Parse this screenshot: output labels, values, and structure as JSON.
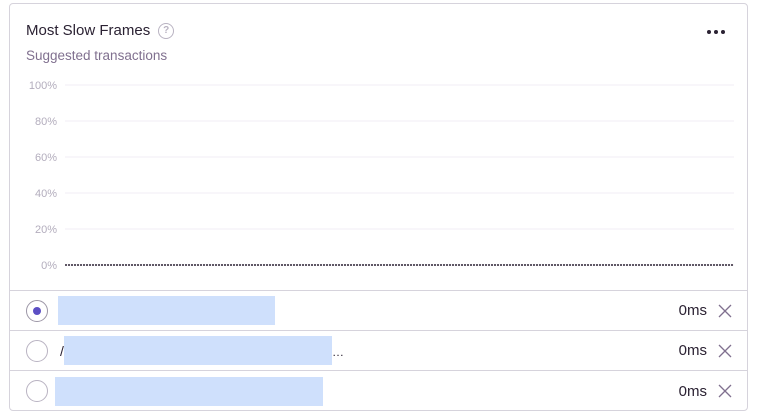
{
  "widget": {
    "title": "Most Slow Frames",
    "subtitle": "Suggested transactions",
    "help_icon": "question-circle-icon",
    "menu_icon": "ellipsis-icon"
  },
  "chart_data": {
    "type": "line",
    "y_ticks": [
      "100%",
      "80%",
      "60%",
      "40%",
      "20%",
      "0%"
    ],
    "ylim": [
      0,
      100
    ],
    "grid": true,
    "series": [
      {
        "values": [
          0,
          0
        ]
      }
    ]
  },
  "transactions": [
    {
      "selected": true,
      "prefix": "",
      "ellipsis": "",
      "value": "0ms"
    },
    {
      "selected": false,
      "prefix": "/",
      "ellipsis": "…",
      "value": "0ms"
    },
    {
      "selected": false,
      "prefix": "",
      "ellipsis": "",
      "value": "0ms"
    }
  ],
  "colors": {
    "accent": "#5c4fc4",
    "redaction": "#cfe0fc",
    "gridline": "#f0eef4",
    "baseline": "#2b2233"
  }
}
